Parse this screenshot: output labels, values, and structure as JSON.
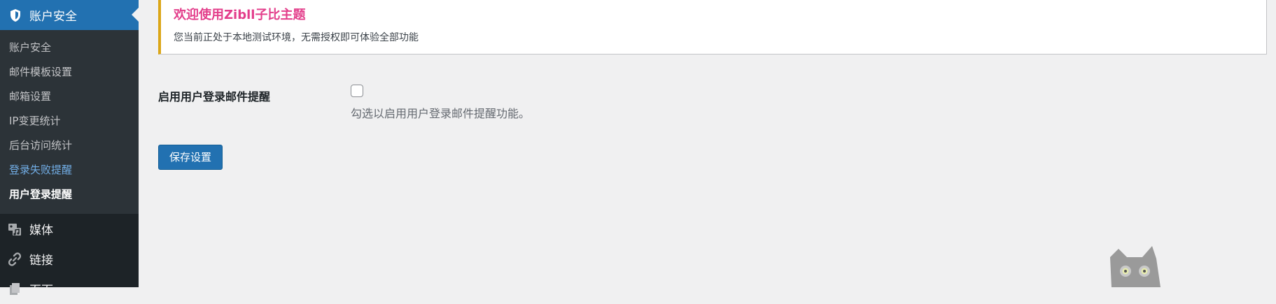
{
  "sidebar": {
    "current_menu": {
      "label": "账户安全",
      "icon": "shield-icon"
    },
    "submenu": [
      {
        "label": "账户安全"
      },
      {
        "label": "邮件模板设置"
      },
      {
        "label": "邮箱设置"
      },
      {
        "label": "IP变更统计"
      },
      {
        "label": "后台访问统计"
      },
      {
        "label": "登录失败提醒"
      },
      {
        "label": "用户登录提醒"
      }
    ],
    "menus": [
      {
        "label": "媒体",
        "icon": "media-icon"
      },
      {
        "label": "链接",
        "icon": "link-icon"
      },
      {
        "label": "页面",
        "icon": "page-icon"
      }
    ]
  },
  "notice": {
    "title": "欢迎使用Zibll子比主题",
    "description": "您当前正处于本地测试环境，无需授权即可体验全部功能"
  },
  "settings": {
    "login_email_alert": {
      "label": "启用用户登录邮件提醒",
      "description": "勾选以启用用户登录邮件提醒功能。",
      "checked": false
    }
  },
  "actions": {
    "save_label": "保存设置"
  },
  "colors": {
    "sidebar_bg": "#1d2327",
    "submenu_bg": "#2c3338",
    "accent": "#2271b1",
    "notice_border": "#dba617",
    "notice_title": "#e33e8b",
    "link_hover": "#72aee6"
  }
}
